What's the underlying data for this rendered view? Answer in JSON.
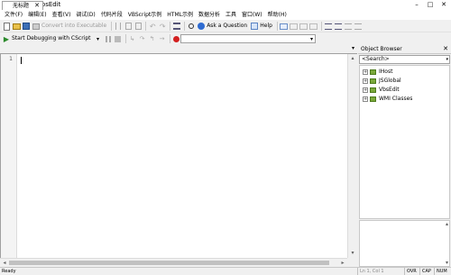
{
  "window": {
    "title": "无标题 - VbsEdit"
  },
  "menu": [
    "文件(F)",
    "编辑(E)",
    "查看(V)",
    "调试(D)",
    "代码片段",
    "VBScript示例",
    "HTML示例",
    "数据分析",
    "工具",
    "窗口(W)",
    "帮助(H)"
  ],
  "toolbar": {
    "convert_label": "Convert into Executable",
    "ask_label": "Ask a Question",
    "help_label": "Help"
  },
  "debugbar": {
    "start_label": "Start Debugging with CScript"
  },
  "editor": {
    "tab_label": "无标题",
    "line_number": "1"
  },
  "object_browser": {
    "title": "Object Browser",
    "search_value": "<Search>",
    "items": [
      "IHost",
      "JSGlobal",
      "VbsEdit",
      "WMI Classes"
    ]
  },
  "status": {
    "ready": "Ready",
    "position": "Ln 1, Col 1",
    "ovr": "OVR",
    "cap": "CAP",
    "num": "NUM"
  }
}
